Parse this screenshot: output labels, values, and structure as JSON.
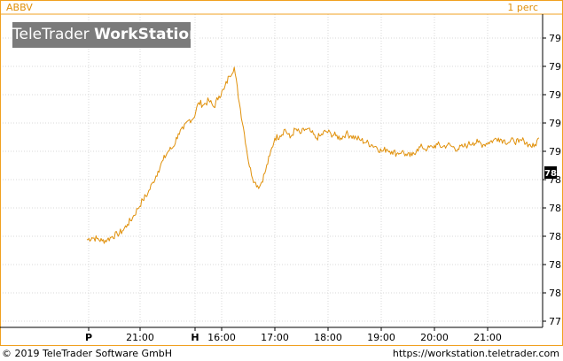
{
  "header": {
    "symbol": "ABBV",
    "period": "1 perc"
  },
  "watermark": {
    "brand": "TeleTrader",
    "product": "WorkStation"
  },
  "footer": {
    "copyright": "© 2019 TeleTrader Software GmbH",
    "website": "https://workstation.teletrader.com"
  },
  "colors": {
    "line": "#e0900a",
    "frame": "#f0a020",
    "grid": "#d8d8d8",
    "watermark_bg": "#7b7b7b",
    "marker_bg": "#000000"
  },
  "chart_data": {
    "type": "line",
    "title": "",
    "xlabel": "",
    "ylabel": "",
    "grid": true,
    "y_axis_side": "right",
    "y_ticks": [
      "79",
      "79",
      "79",
      "79",
      "79",
      "78",
      "78",
      "78",
      "78",
      "78",
      "77"
    ],
    "x_ticks": [
      "P",
      "21:00",
      "H",
      "16:00",
      "17:00",
      "18:00",
      "19:00",
      "20:00",
      "21:00"
    ],
    "last_value_label": "78",
    "series": [
      {
        "values": [
          [
            0,
            22
          ],
          [
            0.5,
            23
          ],
          [
            1,
            22.5
          ],
          [
            1.5,
            21.5
          ],
          [
            2,
            22
          ],
          [
            2.5,
            23.5
          ],
          [
            3,
            24.5
          ],
          [
            3.5,
            26
          ],
          [
            4,
            29
          ],
          [
            4.5,
            32
          ],
          [
            5,
            36
          ],
          [
            5.5,
            40
          ],
          [
            6,
            43
          ],
          [
            6.5,
            48
          ],
          [
            7,
            53
          ],
          [
            7.5,
            58
          ],
          [
            8,
            62
          ],
          [
            8.5,
            64
          ],
          [
            9,
            70
          ],
          [
            9.5,
            72
          ],
          [
            10,
            76
          ],
          [
            10.5,
            77
          ],
          [
            11,
            84
          ],
          [
            11.5,
            83
          ],
          [
            12,
            85
          ],
          [
            12.5,
            82
          ],
          [
            13,
            87
          ],
          [
            13.5,
            90
          ],
          [
            14,
            96
          ],
          [
            14.5,
            100
          ],
          [
            15,
            84
          ],
          [
            15.5,
            70
          ],
          [
            16,
            55
          ],
          [
            16.5,
            48
          ],
          [
            17,
            46
          ],
          [
            17.5,
            52
          ],
          [
            18,
            60
          ],
          [
            18.5,
            68
          ],
          [
            19,
            69
          ],
          [
            19.5,
            72
          ],
          [
            20,
            68
          ],
          [
            20.5,
            72
          ],
          [
            21,
            70
          ],
          [
            21.5,
            72
          ],
          [
            22,
            71
          ],
          [
            22.5,
            68
          ],
          [
            23,
            69
          ],
          [
            23.5,
            71
          ],
          [
            24,
            70
          ],
          [
            24.5,
            69
          ],
          [
            25,
            68
          ],
          [
            25.5,
            70
          ],
          [
            26,
            69
          ],
          [
            26.5,
            68
          ],
          [
            27,
            67
          ],
          [
            27.5,
            66
          ],
          [
            28,
            65
          ],
          [
            28.5,
            64
          ],
          [
            29,
            62
          ],
          [
            29.5,
            63
          ],
          [
            30,
            62
          ],
          [
            30.5,
            61
          ],
          [
            31,
            62
          ],
          [
            31.5,
            60
          ],
          [
            32,
            60
          ],
          [
            32.5,
            63
          ],
          [
            33,
            64
          ],
          [
            33.5,
            63
          ],
          [
            34,
            64
          ],
          [
            34.5,
            65
          ],
          [
            35,
            64
          ],
          [
            35.5,
            65
          ],
          [
            36,
            64
          ],
          [
            36.5,
            63
          ],
          [
            37,
            64
          ],
          [
            37.5,
            65
          ],
          [
            38,
            66
          ],
          [
            38.5,
            66
          ],
          [
            39,
            65
          ],
          [
            39.5,
            66
          ],
          [
            40,
            67
          ],
          [
            40.5,
            68
          ],
          [
            41,
            67
          ],
          [
            41.5,
            66
          ],
          [
            42,
            67
          ],
          [
            42.5,
            66
          ],
          [
            43,
            67
          ],
          [
            43.5,
            65
          ],
          [
            44,
            64
          ],
          [
            44.5,
            68
          ]
        ]
      }
    ]
  }
}
